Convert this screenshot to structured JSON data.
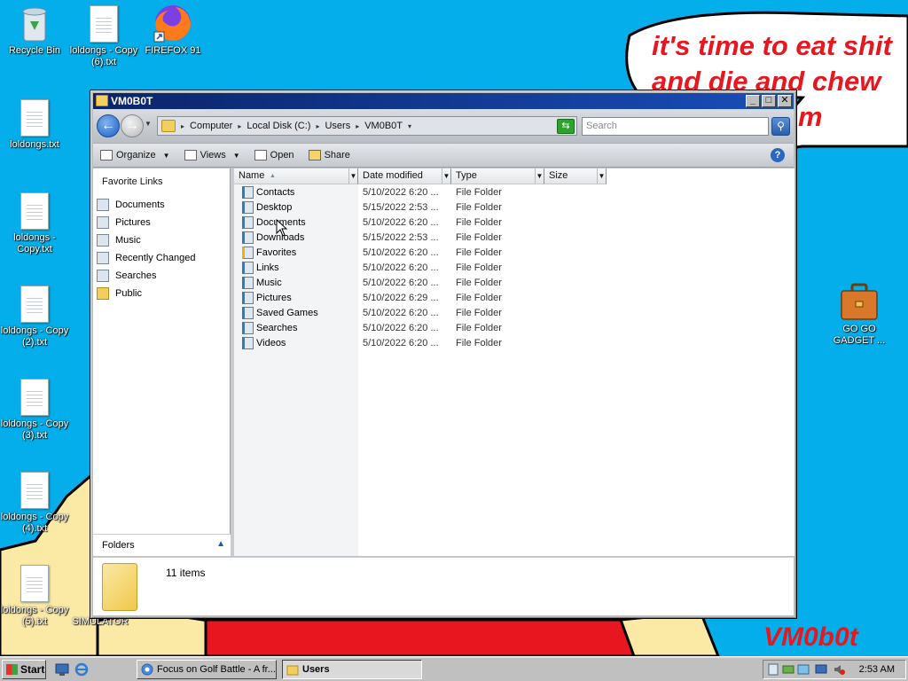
{
  "wallpaper": {
    "speech_bubble": "it's time to eat shit and die and chew gum",
    "caption_line1": "it's time to eat shit",
    "caption_line2": "and die and chew",
    "caption_line3": "m",
    "signature": "VM0b0t",
    "colors": {
      "sky": "#04aeea",
      "red": "#e8161e",
      "skin": "#fbe9a6"
    }
  },
  "desktop_icons": [
    {
      "label": "Recycle Bin",
      "icon": "recycle-bin-icon"
    },
    {
      "label": "loldongs - Copy (6).txt",
      "icon": "text-file-icon"
    },
    {
      "label": "FIREFOX 91",
      "icon": "firefox-icon"
    },
    {
      "label": "loldongs.txt",
      "icon": "text-file-icon"
    },
    {
      "label": "loldongs - Copy.txt",
      "icon": "text-file-icon"
    },
    {
      "label": "loldongs - Copy (2).txt",
      "icon": "text-file-icon"
    },
    {
      "label": "loldongs - Copy (3).txt",
      "icon": "text-file-icon"
    },
    {
      "label": "loldongs - Copy (4).txt",
      "icon": "text-file-icon"
    },
    {
      "label": "loldongs - Copy (5).txt",
      "icon": "text-file-icon"
    },
    {
      "label": "GO GO GADGET ...",
      "icon": "briefcase-icon"
    },
    {
      "label": "SIMULATOR",
      "icon": "app-icon"
    }
  ],
  "window": {
    "title": "VM0B0T",
    "breadcrumb": [
      "Computer",
      "Local Disk (C:)",
      "Users",
      "VM0B0T"
    ],
    "search_placeholder": "Search",
    "toolbar": {
      "organize": "Organize",
      "views": "Views",
      "open": "Open",
      "share": "Share"
    },
    "nav_heading": "Favorite Links",
    "nav_links": [
      {
        "label": "Documents",
        "icon": "documents-icon"
      },
      {
        "label": "Pictures",
        "icon": "pictures-icon"
      },
      {
        "label": "Music",
        "icon": "music-icon"
      },
      {
        "label": "Recently Changed",
        "icon": "recent-icon"
      },
      {
        "label": "Searches",
        "icon": "search-folder-icon"
      },
      {
        "label": "Public",
        "icon": "folder-icon"
      }
    ],
    "folders_label": "Folders",
    "columns": {
      "name": "Name",
      "date": "Date modified",
      "type": "Type",
      "size": "Size"
    },
    "files": [
      {
        "name": "Contacts",
        "date": "5/10/2022 6:20 ...",
        "type": "File Folder",
        "icon": "contacts-folder-icon"
      },
      {
        "name": "Desktop",
        "date": "5/15/2022 2:53 ...",
        "type": "File Folder",
        "icon": "desktop-folder-icon"
      },
      {
        "name": "Documents",
        "date": "5/10/2022 6:20 ...",
        "type": "File Folder",
        "icon": "documents-folder-icon"
      },
      {
        "name": "Downloads",
        "date": "5/15/2022 2:53 ...",
        "type": "File Folder",
        "icon": "downloads-folder-icon"
      },
      {
        "name": "Favorites",
        "date": "5/10/2022 6:20 ...",
        "type": "File Folder",
        "icon": "favorites-folder-icon"
      },
      {
        "name": "Links",
        "date": "5/10/2022 6:20 ...",
        "type": "File Folder",
        "icon": "links-folder-icon"
      },
      {
        "name": "Music",
        "date": "5/10/2022 6:20 ...",
        "type": "File Folder",
        "icon": "music-folder-icon"
      },
      {
        "name": "Pictures",
        "date": "5/10/2022 6:29 ...",
        "type": "File Folder",
        "icon": "pictures-folder-icon"
      },
      {
        "name": "Saved Games",
        "date": "5/10/2022 6:20 ...",
        "type": "File Folder",
        "icon": "saved-games-folder-icon"
      },
      {
        "name": "Searches",
        "date": "5/10/2022 6:20 ...",
        "type": "File Folder",
        "icon": "searches-folder-icon"
      },
      {
        "name": "Videos",
        "date": "5/10/2022 6:20 ...",
        "type": "File Folder",
        "icon": "videos-folder-icon"
      }
    ],
    "item_count": "11 items"
  },
  "taskbar": {
    "start": "Start",
    "tasks": [
      {
        "label": "Focus on Golf Battle - A fr...",
        "active": false
      },
      {
        "label": "Users",
        "active": true
      }
    ],
    "clock": "2:53 AM"
  }
}
